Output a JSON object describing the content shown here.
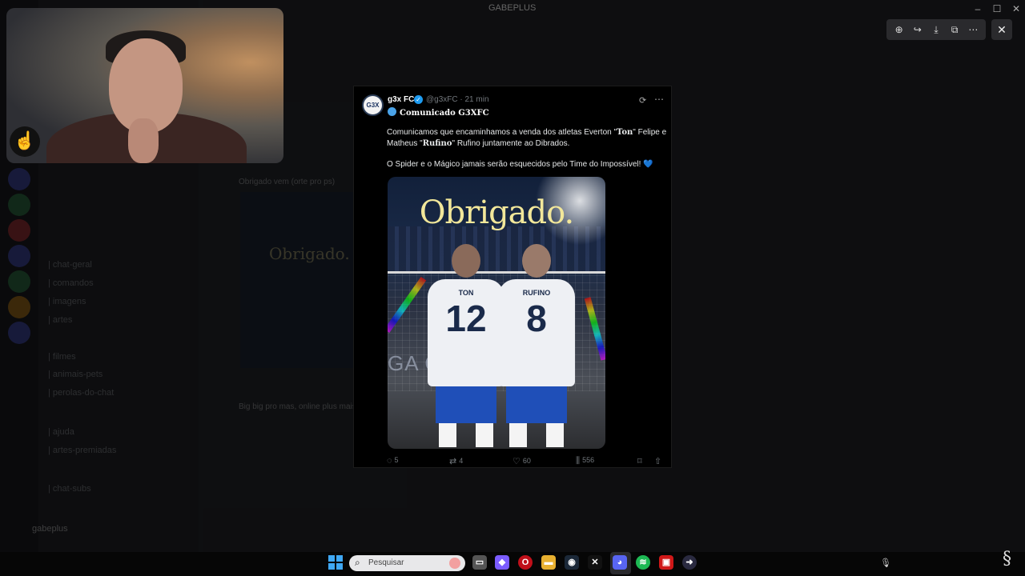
{
  "window": {
    "title": "GABEPLUS"
  },
  "viewer_tools": {
    "zoom_icon": "zoom-in-icon",
    "forward_icon": "forward-icon",
    "download_icon": "download-icon",
    "open_icon": "open-external-icon",
    "more_icon": "more-icon",
    "close_icon": "close-icon"
  },
  "webcam": {
    "label": "Webcam overlay"
  },
  "tweet": {
    "avatar_text": "G3X",
    "name": "g3x FC",
    "handle_time": "@g3xFC · 21 min",
    "subtitle": "Comunicado G3XFC",
    "para1_a": "Comunicamos que encaminhamos a venda dos atletas Everton \"",
    "para1_b": "Ton",
    "para1_c": "\" Felipe e Matheus \"",
    "para1_d": "Rufino",
    "para1_e": "\" Rufino juntamente ao Dibrados.",
    "para2": "O Spider e o Mágico jamais serão esquecidos pelo Time do Impossível! 💙",
    "image": {
      "title": "Obrigado.",
      "bg_text": "GA     O   RUF",
      "player1_name": "TON",
      "player1_number": "12",
      "player2_name": "RUFINO",
      "player2_number": "8"
    },
    "actions": {
      "replies": "5",
      "reposts": "4",
      "likes": "60",
      "views": "556"
    }
  },
  "background": {
    "channels": [
      "| chat-geral",
      "| comandos",
      "| imagens",
      "| artes",
      "| filmes",
      "| animais-pets",
      "| perolas-do-chat",
      "| ajuda",
      "| artes-premiadas",
      "| chat-subs"
    ],
    "chat_line1": "Obrigado vem (orte pro ps)",
    "chat_line2": "Big big pro mas, online plus mais",
    "user": "gabeplus"
  },
  "taskbar": {
    "search_placeholder": "Pesquisar"
  }
}
